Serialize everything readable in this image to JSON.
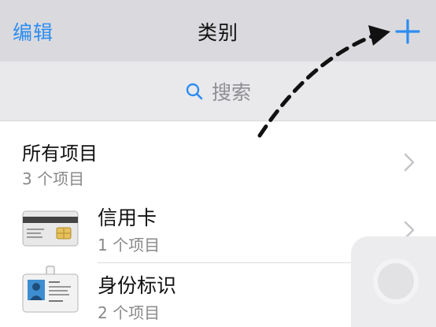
{
  "navbar": {
    "edit_label": "编辑",
    "title": "类别",
    "add_icon": "plus-icon",
    "accent_color": "#2d8cf0"
  },
  "search": {
    "placeholder": "搜索",
    "icon": "search-icon"
  },
  "list": {
    "items": [
      {
        "title": "所有项目",
        "subtitle": "3 个项目",
        "icon": "none"
      },
      {
        "title": "信用卡",
        "subtitle": "1 个项目",
        "icon": "credit-card-icon"
      },
      {
        "title": "身份标识",
        "subtitle": "2 个项目",
        "icon": "id-badge-icon"
      }
    ]
  }
}
